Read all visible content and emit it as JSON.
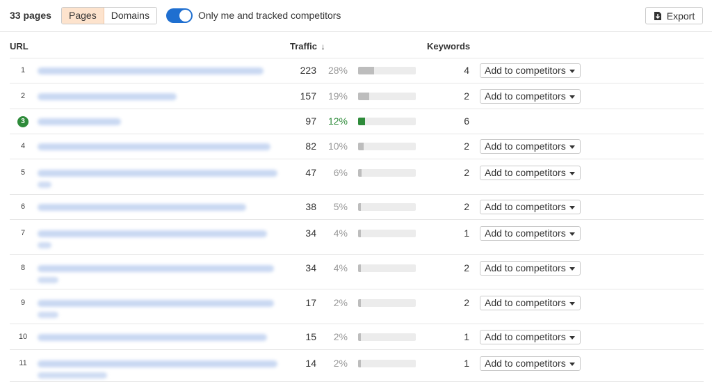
{
  "toolbar": {
    "page_count": "33 pages",
    "tabs": [
      {
        "label": "Pages",
        "active": true
      },
      {
        "label": "Domains",
        "active": false
      }
    ],
    "toggle_on": true,
    "toggle_label": "Only me and tracked competitors",
    "export_label": "Export"
  },
  "columns": {
    "url": "URL",
    "traffic": "Traffic",
    "sort_icon": "↓",
    "keywords": "Keywords"
  },
  "colors": {
    "accent_blue": "#1f6fd0",
    "own_site_green": "#2e8b3a",
    "tab_active": "#fde3cd"
  },
  "add_button_label": "Add to competitors",
  "rows": [
    {
      "num": "1",
      "traffic": "223",
      "pct": "28%",
      "share": 0.28,
      "keywords": "4",
      "own": false,
      "add_button": true
    },
    {
      "num": "2",
      "traffic": "157",
      "pct": "19%",
      "share": 0.19,
      "keywords": "2",
      "own": false,
      "add_button": true
    },
    {
      "num": "3",
      "traffic": "97",
      "pct": "12%",
      "share": 0.12,
      "keywords": "6",
      "own": true,
      "add_button": false
    },
    {
      "num": "4",
      "traffic": "82",
      "pct": "10%",
      "share": 0.1,
      "keywords": "2",
      "own": false,
      "add_button": true
    },
    {
      "num": "5",
      "traffic": "47",
      "pct": "6%",
      "share": 0.06,
      "keywords": "2",
      "own": false,
      "add_button": true
    },
    {
      "num": "6",
      "traffic": "38",
      "pct": "5%",
      "share": 0.05,
      "keywords": "2",
      "own": false,
      "add_button": true
    },
    {
      "num": "7",
      "traffic": "34",
      "pct": "4%",
      "share": 0.04,
      "keywords": "1",
      "own": false,
      "add_button": true
    },
    {
      "num": "8",
      "traffic": "34",
      "pct": "4%",
      "share": 0.04,
      "keywords": "2",
      "own": false,
      "add_button": true
    },
    {
      "num": "9",
      "traffic": "17",
      "pct": "2%",
      "share": 0.02,
      "keywords": "2",
      "own": false,
      "add_button": true
    },
    {
      "num": "10",
      "traffic": "15",
      "pct": "2%",
      "share": 0.02,
      "keywords": "1",
      "own": false,
      "add_button": true
    },
    {
      "num": "11",
      "traffic": "14",
      "pct": "2%",
      "share": 0.02,
      "keywords": "1",
      "own": false,
      "add_button": true
    }
  ]
}
